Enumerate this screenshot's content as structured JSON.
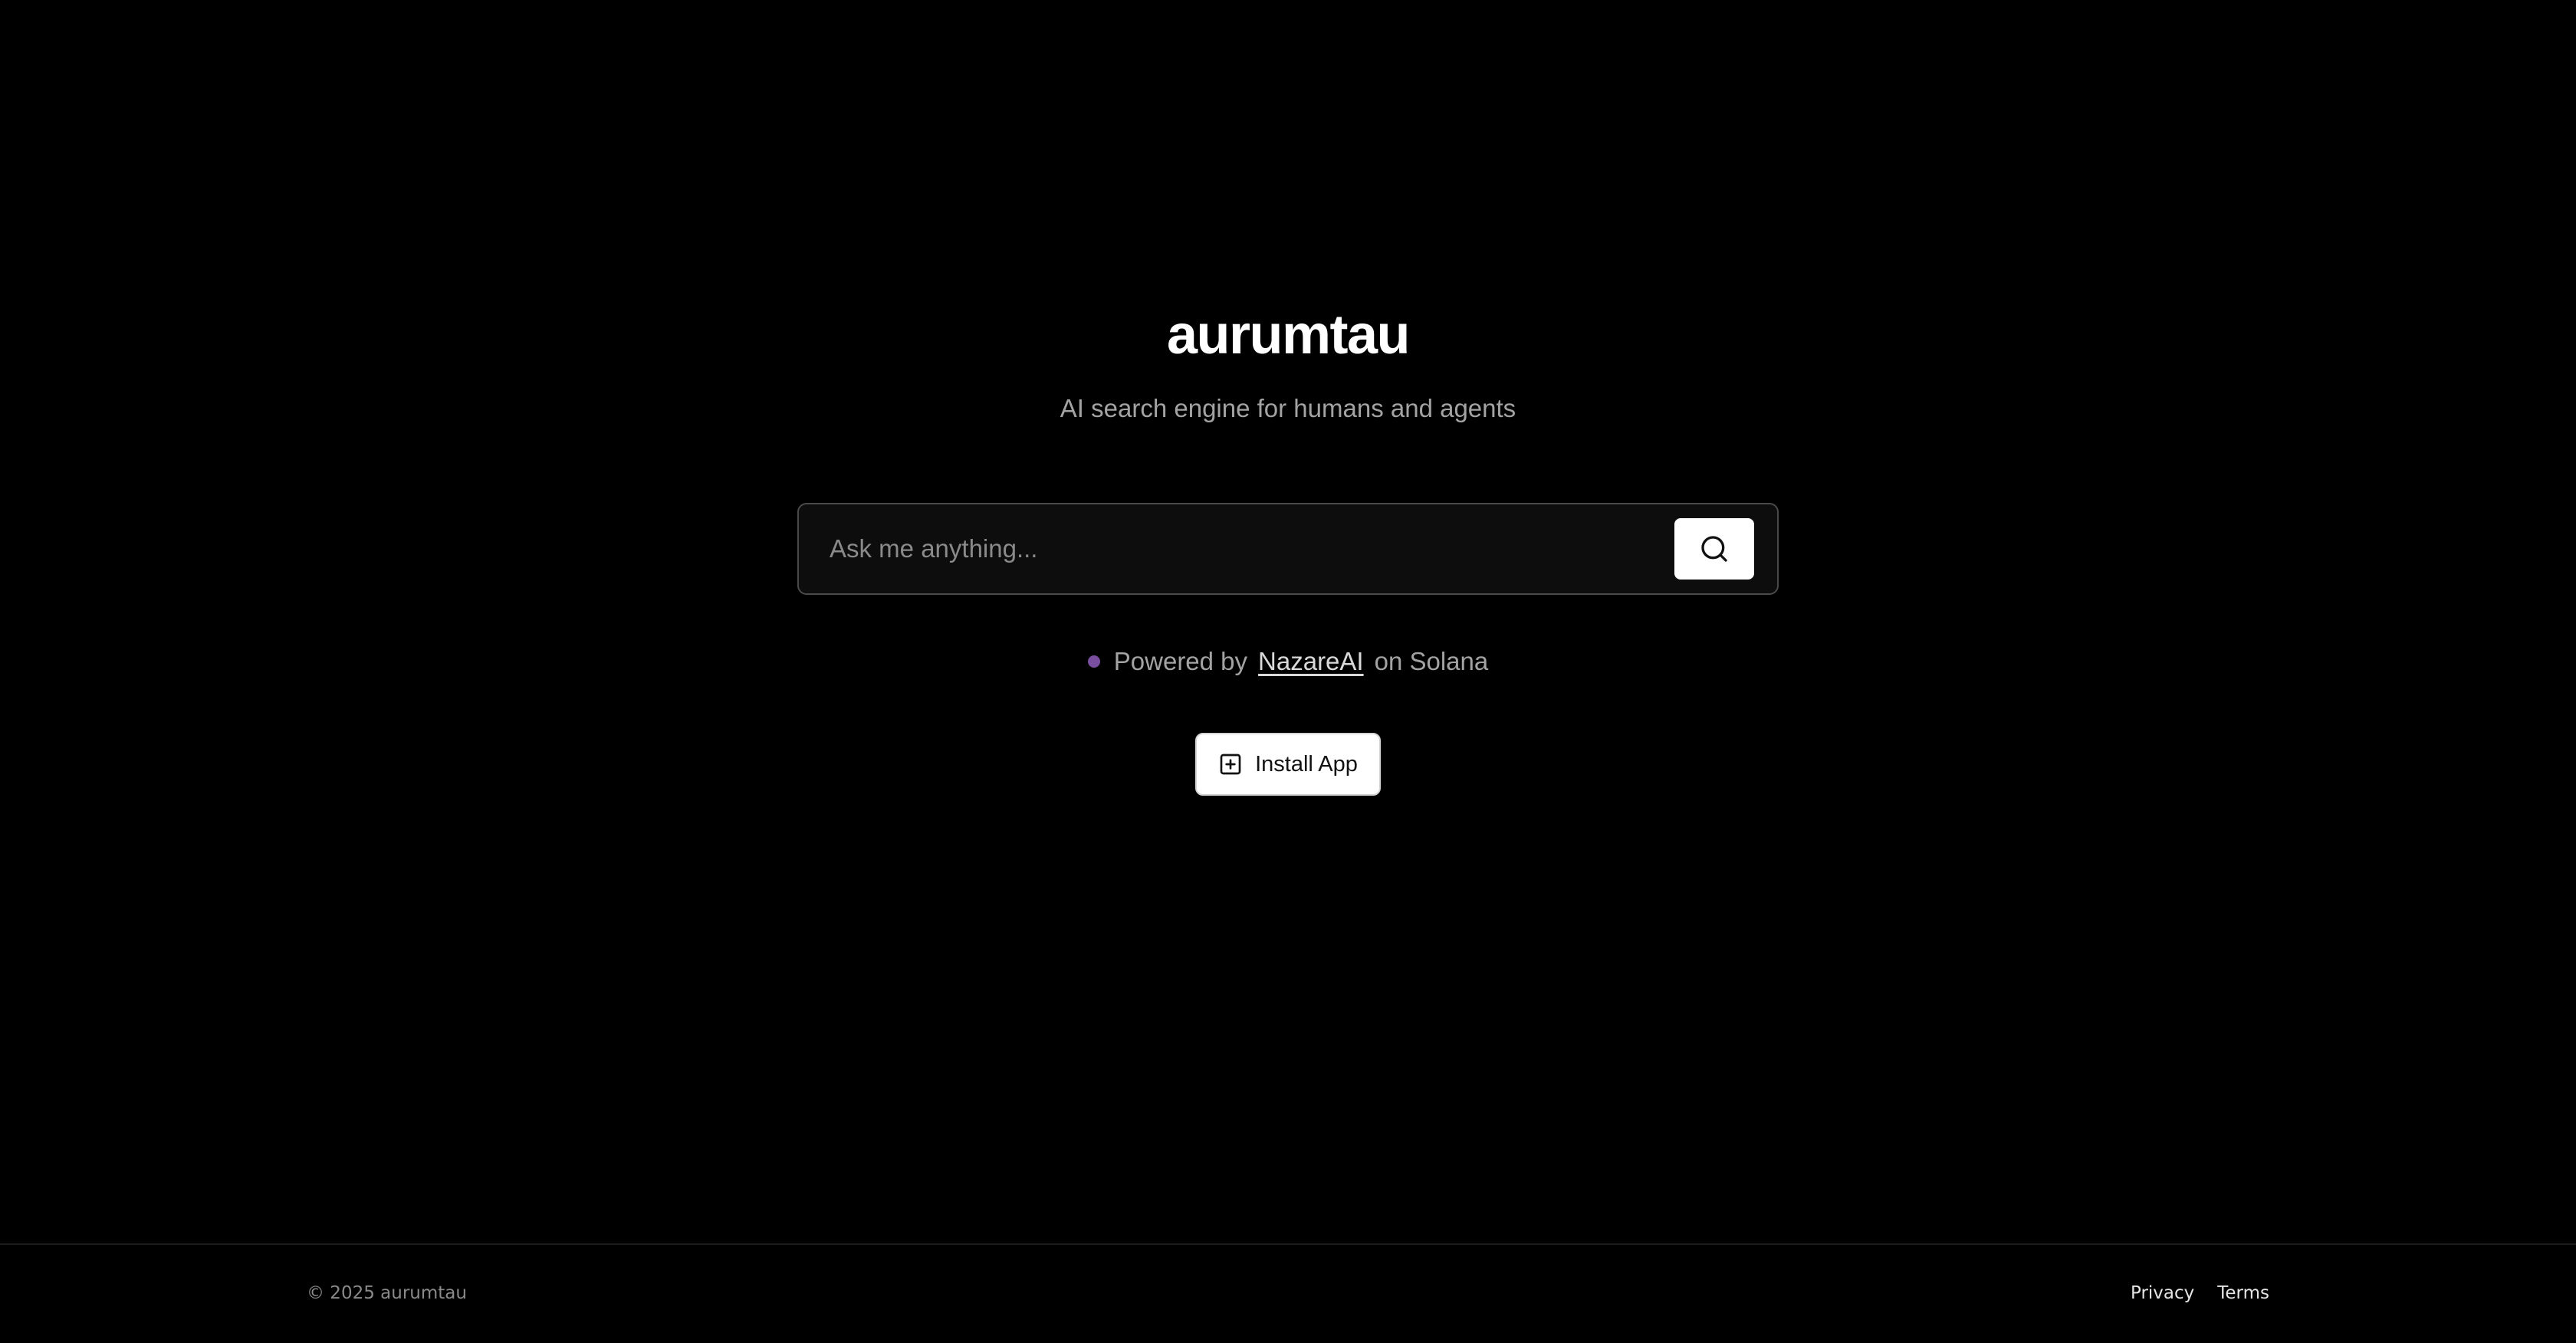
{
  "brand": {
    "title": "aurumtau",
    "tagline": "AI search engine for humans and agents"
  },
  "search": {
    "placeholder": "Ask me anything...",
    "value": "",
    "button_icon": "search-icon"
  },
  "powered_by": {
    "prefix": "Powered by",
    "link_text": "NazareAI",
    "suffix": "on Solana",
    "dot_color": "#7b4fa0"
  },
  "install": {
    "label": "Install App",
    "icon": "plus-square-icon"
  },
  "footer": {
    "copyright": "© 2025 aurumtau",
    "links": [
      {
        "label": "Privacy"
      },
      {
        "label": "Terms"
      }
    ]
  },
  "colors": {
    "background": "#000000",
    "text_primary": "#ffffff",
    "text_muted": "#a3a3a3"
  }
}
